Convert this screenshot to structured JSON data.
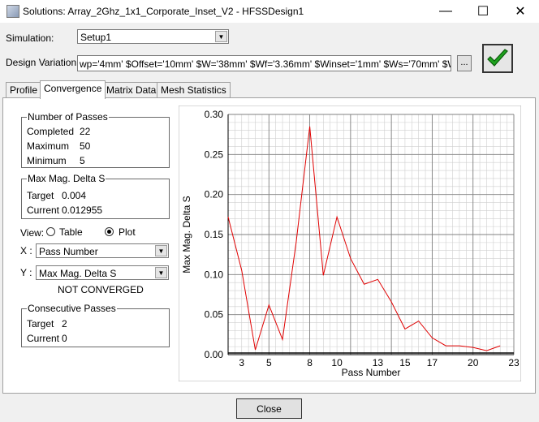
{
  "window": {
    "title": "Solutions: Array_2Ghz_1x1_Corporate_Inset_V2 - HFSSDesign1",
    "minimize_glyph": "—",
    "maximize_glyph": "☐",
    "close_glyph": "✕"
  },
  "simulation": {
    "label": "Simulation:",
    "value": "Setup1"
  },
  "design_variation": {
    "label": "Design Variation:",
    "value": "wp='4mm' $Offset='10mm' $W='38mm' $Wf='3.36mm' $Winset='1mm' $Ws='70mm' $Wwp='10mm'",
    "browse_label": "..."
  },
  "tabs": [
    {
      "label": "Profile",
      "active": false
    },
    {
      "label": "Convergence",
      "active": true
    },
    {
      "label": "Matrix Data",
      "active": false
    },
    {
      "label": "Mesh Statistics",
      "active": false
    }
  ],
  "passes": {
    "legend": "Number of Passes",
    "completed_label": "Completed",
    "completed": "22",
    "maximum_label": "Maximum",
    "maximum": "50",
    "minimum_label": "Minimum",
    "minimum": "5"
  },
  "delta_s": {
    "legend": "Max Mag. Delta S",
    "target_label": "Target",
    "target": "0.004",
    "current_label": "Current",
    "current": "0.012955"
  },
  "view": {
    "label": "View:",
    "table_label": "Table",
    "plot_label": "Plot",
    "selected": "Plot"
  },
  "x_axis_select": {
    "label": "X :",
    "value": "Pass Number"
  },
  "y_axis_select": {
    "label": "Y :",
    "value": "Max Mag. Delta S"
  },
  "status": "NOT CONVERGED",
  "consecutive": {
    "legend": "Consecutive Passes",
    "target_label": "Target",
    "target": "2",
    "current_label": "Current",
    "current": "0"
  },
  "close_label": "Close",
  "colors": {
    "series": "#e00000",
    "grid_major": "#808080",
    "grid_minor": "#cfcfcf"
  },
  "chart_data": {
    "type": "line",
    "xlabel": "Pass Number",
    "ylabel": "Max Mag. Delta S",
    "xlim": [
      2,
      23
    ],
    "ylim": [
      0,
      0.3
    ],
    "x_ticks": [
      "3",
      "5",
      "8",
      "10",
      "13",
      "15",
      "17",
      "20",
      "23"
    ],
    "y_ticks": [
      "0.00",
      "0.05",
      "0.10",
      "0.15",
      "0.20",
      "0.25",
      "0.30"
    ],
    "grid": true,
    "series": [
      {
        "x": [
          2,
          3,
          4,
          5,
          6,
          7,
          8,
          9,
          10,
          11,
          12,
          13,
          14,
          15,
          16,
          17,
          18,
          19,
          20,
          21,
          22
        ],
        "values": [
          0.172,
          0.105,
          0.006,
          0.062,
          0.019,
          0.14,
          0.285,
          0.099,
          0.172,
          0.12,
          0.088,
          0.094,
          0.066,
          0.032,
          0.042,
          0.021,
          0.011,
          0.011,
          0.009,
          0.005,
          0.011
        ]
      }
    ]
  }
}
